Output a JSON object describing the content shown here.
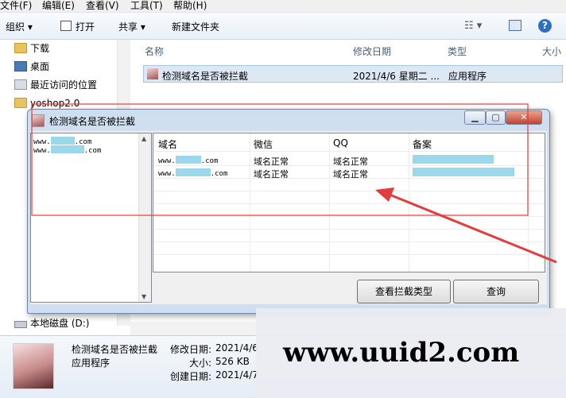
{
  "menu": [
    "文件(F)",
    "编辑(E)",
    "查看(V)",
    "工具(T)",
    "帮助(H)"
  ],
  "toolbar": {
    "organize": "组织 ▾",
    "open": "打开",
    "share": "共享 ▾",
    "new_folder": "新建文件夹"
  },
  "nav": {
    "items": [
      "下载",
      "桌面",
      "最近访问的位置",
      "yoshop2.0"
    ],
    "drive": "本地磁盘 (D:)"
  },
  "columns": {
    "name": "名称",
    "modified": "修改日期",
    "type": "类型",
    "size": "大小"
  },
  "file": {
    "name": "检测域名是否被拦截",
    "modified": "2021/4/6 星期二 ...",
    "type": "应用程序"
  },
  "details": {
    "name": "检测域名是否被拦截",
    "type": "应用程序",
    "modified_label": "修改日期:",
    "modified_value": "2021/4/6",
    "size_label": "大小:",
    "size_value": "526 KB",
    "created_label": "创建日期:",
    "created_value": "2021/4/7"
  },
  "dialog": {
    "title": "检测域名是否被拦截",
    "list": [
      {
        "prefix": "www.",
        "suffix": ".com"
      },
      {
        "prefix": "www.",
        "suffix": ".com"
      }
    ],
    "headers": [
      "域名",
      "微信",
      "QQ",
      "备案"
    ],
    "rows": [
      {
        "domain_prefix": "www.",
        "domain_suffix": ".com",
        "wechat": "域名正常",
        "qq": "域名正常"
      },
      {
        "domain_prefix": "www.",
        "domain_suffix": ".com",
        "wechat": "域名正常",
        "qq": "域名正常"
      }
    ],
    "btn_types": "查看拦截类型",
    "btn_query": "查询"
  },
  "watermark": "www.uuid2.com",
  "colors": {
    "annotation": "#e23c3c",
    "redaction": "#9cd8ec"
  }
}
